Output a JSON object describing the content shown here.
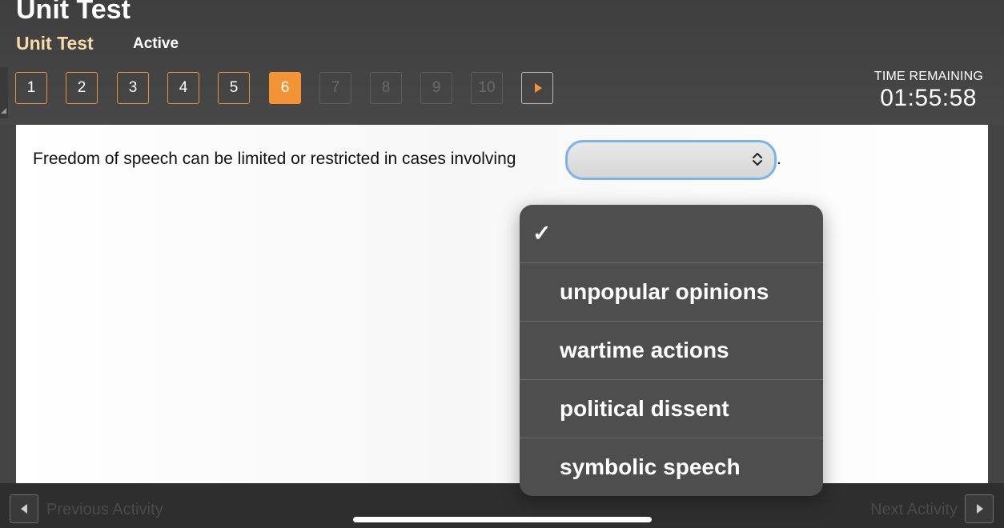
{
  "header": {
    "title": "Unit Test",
    "subtitle": "Unit Test",
    "status": "Active"
  },
  "question_nav": {
    "buttons": [
      {
        "label": "1",
        "state": "answered"
      },
      {
        "label": "2",
        "state": "answered"
      },
      {
        "label": "3",
        "state": "answered"
      },
      {
        "label": "4",
        "state": "answered"
      },
      {
        "label": "5",
        "state": "answered"
      },
      {
        "label": "6",
        "state": "current"
      },
      {
        "label": "7",
        "state": "locked"
      },
      {
        "label": "8",
        "state": "locked"
      },
      {
        "label": "9",
        "state": "locked"
      },
      {
        "label": "10",
        "state": "locked"
      }
    ],
    "next_icon": "play-arrow-icon"
  },
  "timer": {
    "label": "TIME REMAINING",
    "value": "01:55:58"
  },
  "question": {
    "text": "Freedom of speech can be limited or restricted in cases involving",
    "trailing": ".",
    "selected_value": ""
  },
  "dropdown": {
    "selected_icon": "checkmark-icon",
    "options": [
      {
        "label": "",
        "selected": true
      },
      {
        "label": "unpopular opinions",
        "selected": false
      },
      {
        "label": "wartime actions",
        "selected": false
      },
      {
        "label": "political dissent",
        "selected": false
      },
      {
        "label": "symbolic speech",
        "selected": false
      }
    ]
  },
  "footer": {
    "previous_label": "Previous Activity",
    "next_label": "Next Activity"
  },
  "colors": {
    "accent": "#f29433",
    "subtitle": "#f5dca6",
    "focus_ring": "#7db3ea",
    "header_bg": "#444444",
    "dropdown_bg": "#4e4e4e"
  }
}
